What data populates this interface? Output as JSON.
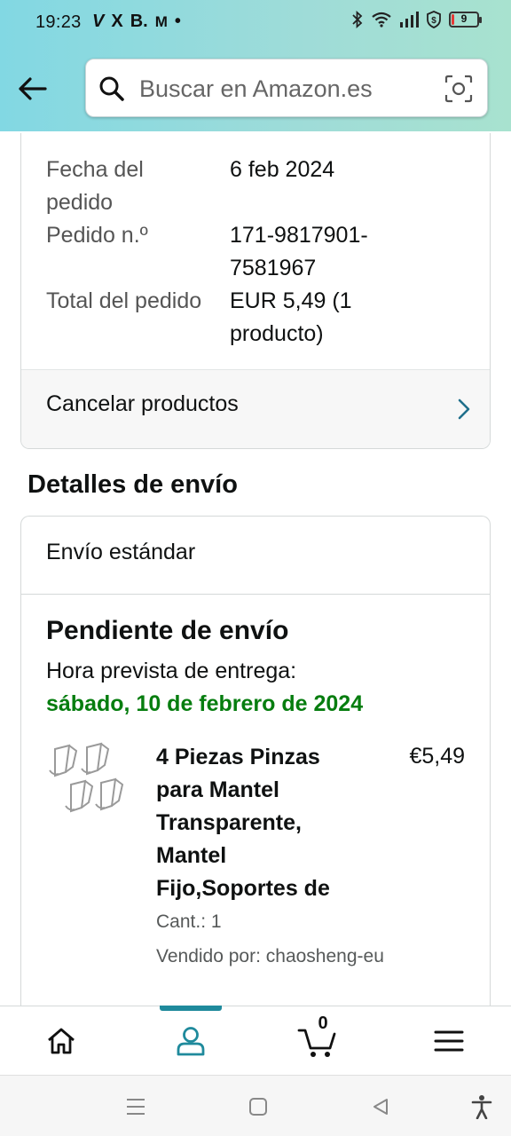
{
  "status_bar": {
    "time": "19:23",
    "app_icons": [
      "V",
      "X",
      "B.",
      "M",
      "•"
    ],
    "battery_level": "9",
    "battery_color": "#e53935"
  },
  "header": {
    "back_icon": "arrow-left-icon",
    "search_placeholder": "Buscar en Amazon.es",
    "camera_icon": "camera-scan-icon"
  },
  "order_summary": {
    "rows": [
      {
        "label": "Fecha del pedido",
        "value": "6 feb 2024"
      },
      {
        "label": "Pedido n.º",
        "value": "171-9817901-7581967"
      },
      {
        "label": "Total del pedido",
        "value": "EUR 5,49 (1 producto)"
      }
    ],
    "cancel_label": "Cancelar productos"
  },
  "shipping": {
    "section_title": "Detalles de envío",
    "method": "Envío estándar",
    "status": "Pendiente de envío",
    "eta_label": "Hora prevista de entrega:",
    "eta_date": "sábado, 10 de febrero de 2024",
    "eta_color": "#067d0f"
  },
  "product": {
    "title": "4 Piezas Pinzas para Mantel Transparente, Mantel Fijo,Soportes de",
    "price": "€5,49",
    "quantity": "Cant.: 1",
    "seller": "Vendido por: chaosheng-eu"
  },
  "bottom_nav": {
    "items": [
      "home-icon",
      "account-icon",
      "cart-icon",
      "menu-icon"
    ],
    "cart_count": "0",
    "active_color": "#1f8a9c"
  },
  "system_nav": [
    "recents-icon",
    "home-square-icon",
    "back-triangle-icon",
    "accessibility-icon"
  ]
}
